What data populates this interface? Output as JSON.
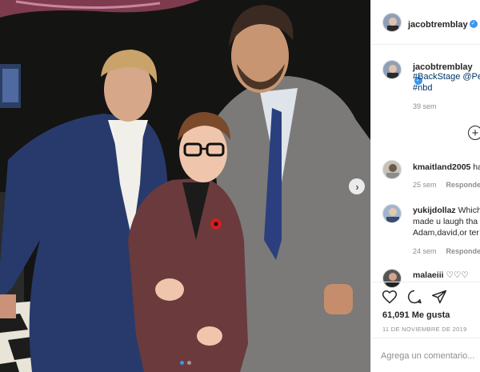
{
  "post": {
    "author": "jacobtremblay",
    "caption_lines": [
      "#BackStage @Pe",
      "#nbd"
    ],
    "time_ago": "39 sem",
    "likes": "61,091 Me gusta",
    "date": "11 DE NOVIEMBRE DE 2019",
    "add_comment_placeholder": "Agrega un comentario...",
    "image_alt": "Backstage photo of three people posing"
  },
  "comments": [
    {
      "user": "kmaitland2005",
      "text": "ha",
      "time": "25 sem",
      "reply": "Responder"
    },
    {
      "user": "yukijdollaz",
      "text": "Which",
      "lines": [
        "made u laugh tha",
        "Adam,david,or ter"
      ],
      "time": "24 sem",
      "reply": "Responder"
    },
    {
      "user": "malaeiii",
      "text": "♡♡♡"
    }
  ],
  "icons": {
    "verified": "verified-badge-icon",
    "more": "plus-circle-icon",
    "like": "heart-icon",
    "comment": "speech-bubble-icon",
    "share": "paper-plane-icon",
    "next": "chevron-right-icon"
  },
  "colors": {
    "accent": "#3897f0",
    "link": "#003569",
    "muted": "#8e8e8e"
  }
}
